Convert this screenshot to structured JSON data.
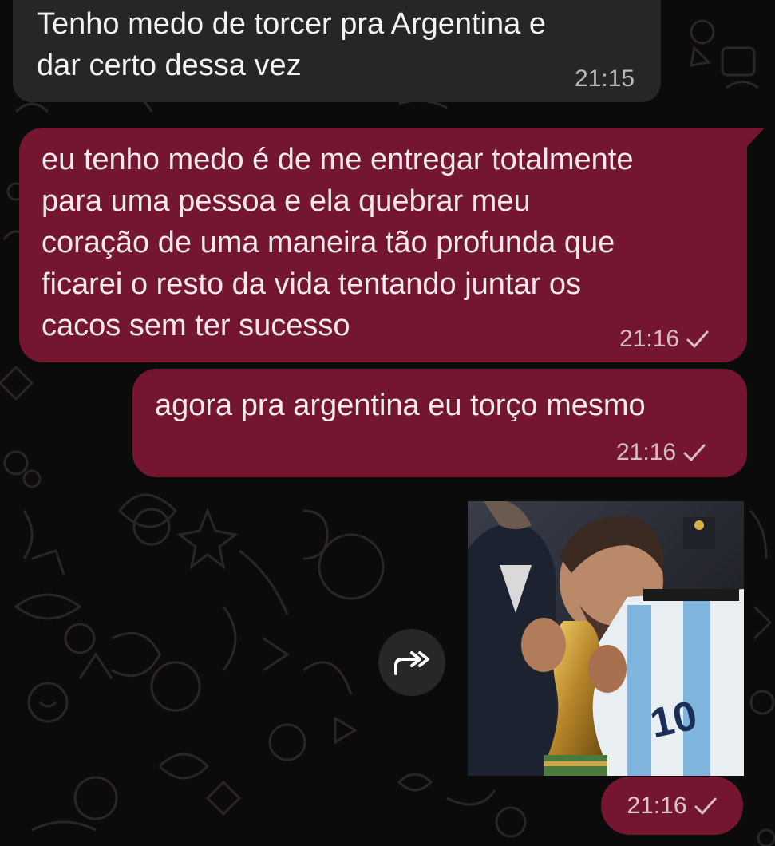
{
  "messages": [
    {
      "direction": "in",
      "text": "Tenho medo de torcer pra Argentina e\ndar certo dessa vez",
      "time": "21:15"
    },
    {
      "direction": "out",
      "text": "eu tenho medo é de me entregar totalmente\npara uma pessoa e ela quebrar meu\ncoração de uma maneira tão profunda que\nficarei o resto da vida tentando juntar os\ncacos sem ter sucesso",
      "time": "21:16",
      "status": "sent"
    },
    {
      "direction": "out",
      "text": "agora pra argentina eu torço mesmo",
      "time": "21:16",
      "status": "sent"
    },
    {
      "direction": "out",
      "type": "image",
      "time": "21:16",
      "status": "sent",
      "jersey_number": "10"
    }
  ],
  "colors": {
    "background": "#0c0b0c",
    "incoming_bubble": "#262626",
    "outgoing_bubble": "#751631"
  },
  "icons": [
    "forward-icon",
    "check-icon"
  ]
}
